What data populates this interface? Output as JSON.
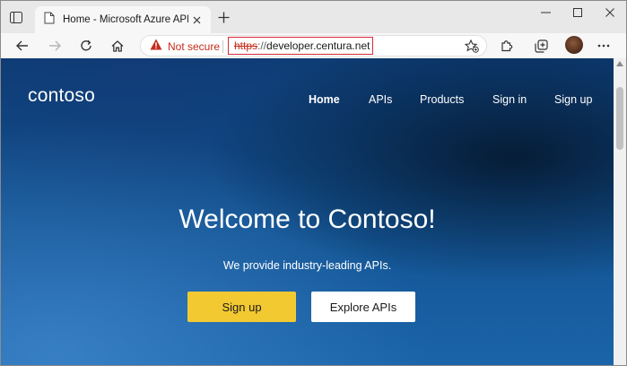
{
  "browser": {
    "tab": {
      "title": "Home - Microsoft Azure API Ma",
      "favicon": "page-icon"
    },
    "window_controls": [
      "minimize-icon",
      "maximize-icon",
      "close-icon"
    ],
    "toolbar": {
      "buttons": [
        "back-icon",
        "forward-icon",
        "refresh-icon",
        "home-icon",
        "extensions-icon",
        "collections-icon"
      ]
    },
    "address": {
      "security_label": "Not secure",
      "url_protocol": "https",
      "url_separator": "://",
      "url_host": "developer.centura.net"
    },
    "colors": {
      "warning": "#c42b1c",
      "highlight_border": "#d9283a"
    }
  },
  "site": {
    "logo": "contoso",
    "nav": [
      "Home",
      "APIs",
      "Products",
      "Sign in",
      "Sign up"
    ],
    "hero": {
      "title": "Welcome to Contoso!",
      "subtitle": "We provide industry-leading APIs.",
      "primary_button": "Sign up",
      "secondary_button": "Explore APIs"
    },
    "colors": {
      "primary_button": "#f3c932",
      "hero_background": "#11508f"
    }
  }
}
